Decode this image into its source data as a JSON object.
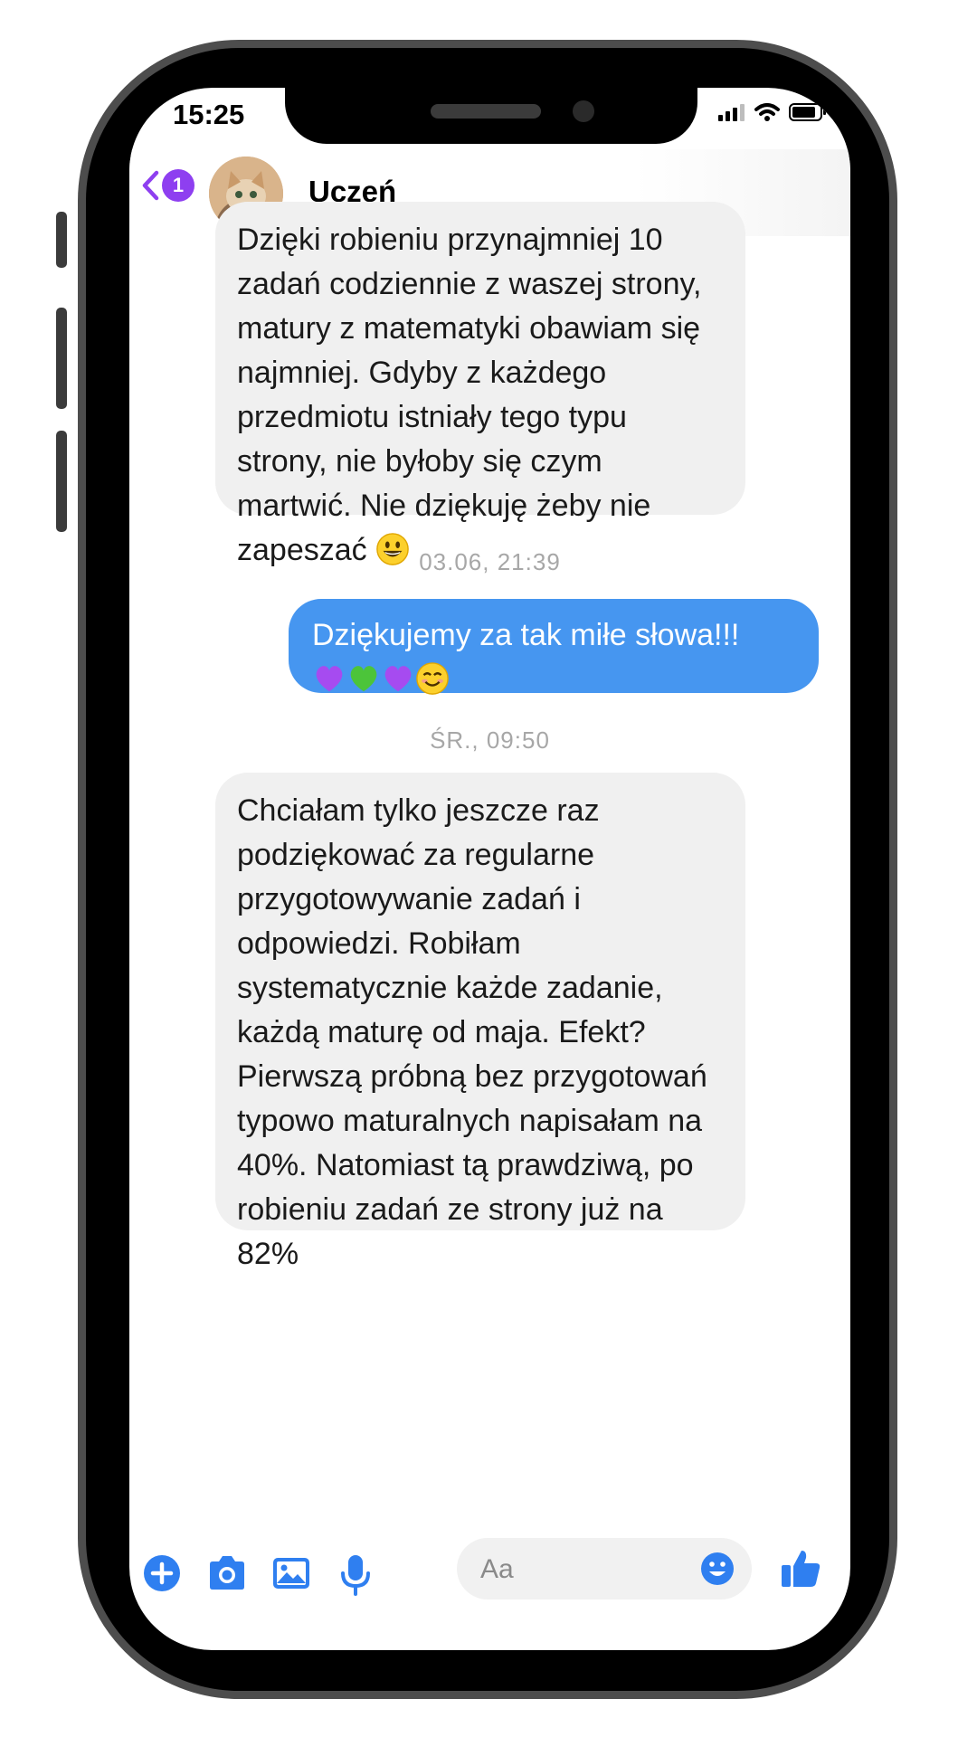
{
  "status_bar": {
    "time": "15:25"
  },
  "header": {
    "back_badge": "1",
    "contact_name": "Uczeń"
  },
  "messages": [
    {
      "direction": "incoming",
      "text": "Dzięki robieniu przynajmniej 10 zadań codziennie z waszej strony, matury z matematyki obawiam się najmniej. Gdyby z każdego przedmiotu istniały tego typu strony, nie byłoby się czym martwić. Nie dziękuję żeby nie zapeszać",
      "trailing_emoji": "grinning-face"
    },
    {
      "timestamp": "03.06, 21:39"
    },
    {
      "direction": "outgoing",
      "text": "Dziękujemy za tak miłe słowa!!!",
      "emojis": [
        "purple-heart",
        "green-heart",
        "purple-heart",
        "smiling-face"
      ]
    },
    {
      "timestamp": "ŚR., 09:50"
    },
    {
      "direction": "incoming",
      "text": "Chciałam tylko jeszcze raz podziękować za regularne przygotowywanie zadań i odpowiedzi. Robiłam systematycznie każde zadanie, każdą maturę od maja. Efekt? Pierwszą próbną bez przygotowań typowo maturalnych napisałam na 40%. Natomiast tą prawdziwą, po robieniu zadań ze strony już na 82%"
    }
  ],
  "composer": {
    "placeholder": "Aa"
  },
  "colors": {
    "accent": "#8e3ff0",
    "outgoing_bubble": "#4696f0",
    "incoming_bubble": "#f0f0f0",
    "toolbar_icon": "#2f7ff0"
  },
  "toolbar": {
    "icons": [
      "plus-icon",
      "camera-icon",
      "image-icon",
      "microphone-icon",
      "emoji-icon",
      "thumbs-up-icon"
    ]
  }
}
